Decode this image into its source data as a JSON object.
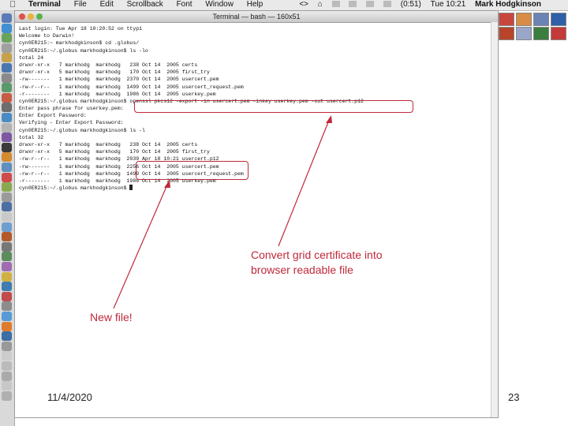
{
  "menubar": {
    "apple": "",
    "items": [
      "Terminal",
      "File",
      "Edit",
      "Scrollback",
      "Font",
      "Window",
      "Help"
    ],
    "status_icons": [
      "<>",
      "⌂"
    ],
    "battery": "(0:51)",
    "clock": "Tue 10:21",
    "user": "Mark Hodgkinson"
  },
  "window": {
    "title": "Terminal — bash — 160x51"
  },
  "terminal": {
    "lines": [
      "Last login: Tue Apr 18 10:20:52 on ttyp1",
      "Welcome to Darwin!",
      "cyn0ER215:~ markhodgkinson$ cd .globus/",
      "cyn0ER215:~/.globus markhodgkinson$ ls -lo",
      "total 24",
      "drwxr-xr-x   7 markhodg  markhodg   238 Oct 14  2005 certs",
      "drwxr-xr-x   5 markhodg  markhodg   170 Oct 14  2005 first_try",
      "-rw-------   1 markhodg  markhodg  2370 Oct 14  2005 usercert.pem",
      "-rw-r--r--   1 markhodg  markhodg  1499 Oct 14  2005 usercert_request.pem",
      "-r--------   1 markhodg  markhodg  1986 Oct 14  2005 userkey.pem",
      "cyn0ER215:~/.globus markhodgkinson$ openssl pkcs12 -export -in usercert.pem -inkey userkey.pem -out usercert.p12",
      "Enter pass phrase for userkey.pem:",
      "Enter Export Password:",
      "Verifying - Enter Export Password:",
      "cyn0ER215:~/.globus markhodgkinson$ ls -l",
      "total 32",
      "drwxr-xr-x   7 markhodg  markhodg   238 Oct 14  2005 certs",
      "drwxr-xr-x   5 markhodg  markhodg   170 Oct 14  2005 first_try",
      "-rw-r--r--   1 markhodg  markhodg  2939 Apr 18 10:21 usercert.p12",
      "-rw-------   1 markhodg  markhodg  2256 Oct 14  2005 usercert.pem",
      "-rw-r--r--   1 markhodg  markhodg  1499 Oct 14  2005 usercert_request.pem",
      "-r--------   1 markhodg  markhodg  1986 Oct 14  2005 userkey.pem",
      "cyn0ER215:~/.globus markhodgkinson$ "
    ]
  },
  "annotations": {
    "convert_note_line1": "Convert grid certificate into",
    "convert_note_line2": "browser readable file",
    "new_file_note": "New file!",
    "color": "#c0283a"
  },
  "footer": {
    "date": "11/4/2020",
    "page": "23"
  }
}
